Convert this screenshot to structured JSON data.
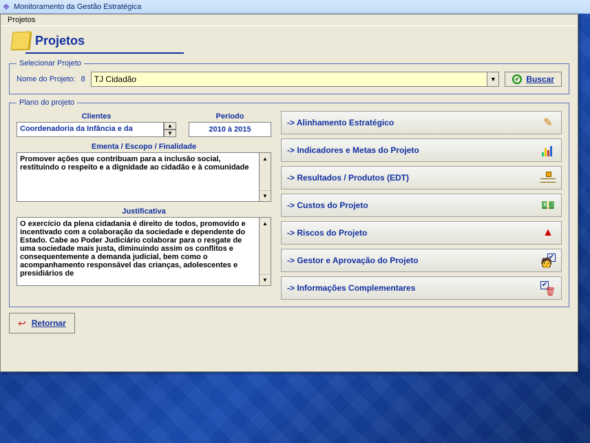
{
  "app": {
    "title": "Monitoramento da Gestão Estratégica",
    "menu": {
      "projetos": "Projetos"
    }
  },
  "header": {
    "title": "Projetos"
  },
  "selecionar": {
    "legend": "Selecionar Projeto",
    "label": "Nome do Projeto:",
    "number": "8",
    "project_name": "TJ Cidadão",
    "buscar": "Buscar"
  },
  "plano": {
    "legend": "Plano do projeto",
    "clientes": {
      "head": "Clientes",
      "value": "Coordenadoria da Infância e da"
    },
    "periodo": {
      "head": "Período",
      "value": "2010 à 2015"
    },
    "ementa": {
      "head": "Ementa / Escopo / Finalidade",
      "text": "Promover ações que contribuam para a inclusão social, restituindo o respeito e a dignidade ao cidadão e à comunidade"
    },
    "justificativa": {
      "head": "Justificativa",
      "text": "O exercício da plena cidadania é direito de todos, promovido e incentivado com a colaboração da sociedade e dependente do Estado. Cabe ao Poder Judiciário colaborar para o resgate de uma sociedade mais justa, diminuindo assim os conflitos e consequentemente a demanda judicial, bem como o acompanhamento responsável das crianças, adolescentes e presidiários de"
    },
    "nav": {
      "alinhamento": "-> Alinhamento Estratégico",
      "indicadores": "-> Indicadores e Metas do Projeto",
      "resultados": "-> Resultados / Produtos (EDT)",
      "custos": "-> Custos do Projeto",
      "riscos": "-> Riscos do Projeto",
      "gestor": "-> Gestor e Aprovação do Projeto",
      "complementares": "-> Informações Complementares"
    }
  },
  "retornar": "Retornar"
}
